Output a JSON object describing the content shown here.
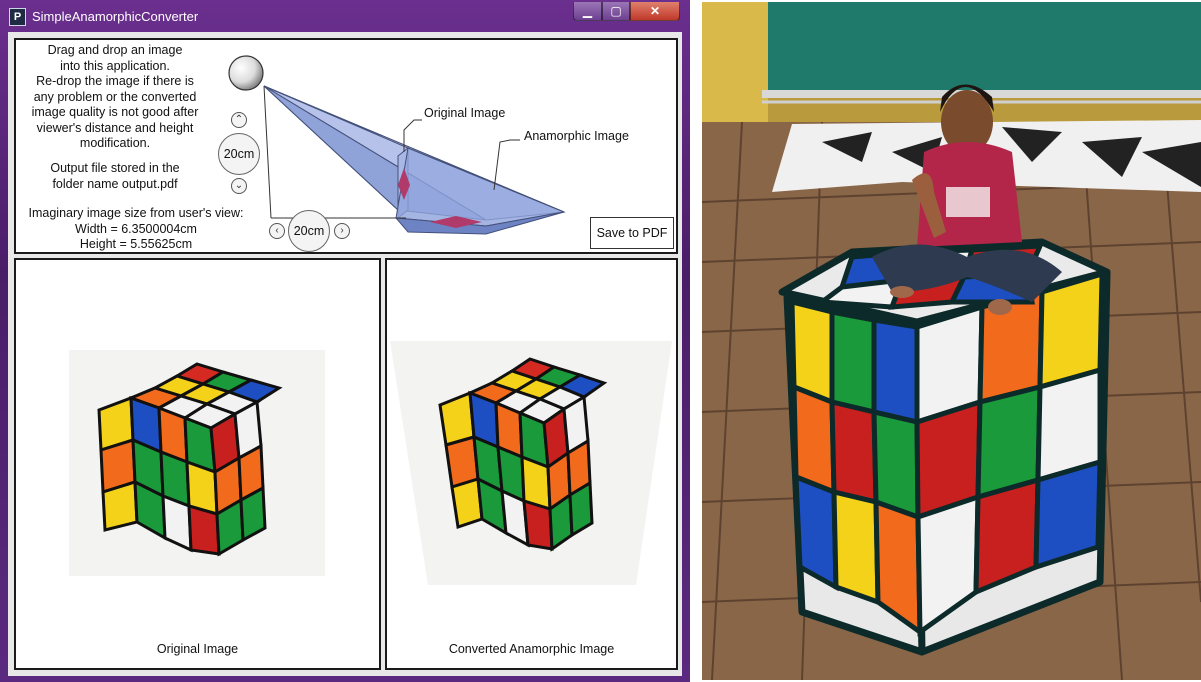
{
  "window": {
    "title": "SimpleAnamorphicConverter",
    "icon": "app-p-icon",
    "buttons": {
      "minimize": "minimize-icon",
      "maximize": "maximize-icon",
      "close": "close-icon"
    }
  },
  "info": {
    "line1": "Drag and drop an image",
    "line2": "into this application.",
    "line3": "Re-drop the image if there is",
    "line4": "any problem or the converted",
    "line5": "image quality is not good after",
    "line6": "viewer's distance and height",
    "line7": "modification.",
    "output1": "Output file stored in the",
    "output2": "folder name output.pdf",
    "size_title": "Imaginary image size from user's view:",
    "width": "Width = 6.3500004cm",
    "height": "Height = 5.55625cm"
  },
  "controls": {
    "height_value": "20cm",
    "distance_value": "20cm",
    "save_label": "Save to PDF"
  },
  "diagram": {
    "original_label": "Original Image",
    "anamorphic_label": "Anamorphic Image"
  },
  "panels": {
    "original_caption": "Original Image",
    "converted_caption": "Converted Anamorphic Image"
  },
  "colors": {
    "window_frame": "#5b2a80",
    "close_button": "#c0392b",
    "prism": "#8aa0d8",
    "diamond": "#b03a6a"
  }
}
